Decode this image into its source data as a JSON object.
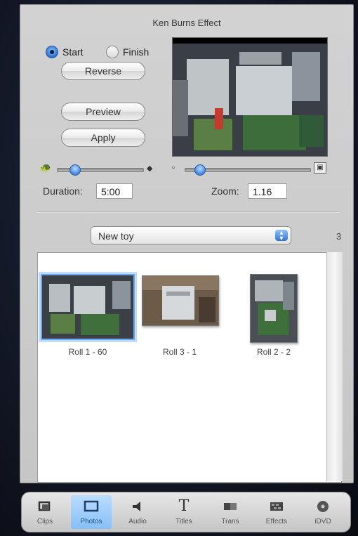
{
  "ken_burns": {
    "title": "Ken Burns Effect",
    "start_label": "Start",
    "finish_label": "Finish",
    "selected": "start",
    "reverse_label": "Reverse",
    "preview_label": "Preview",
    "apply_label": "Apply",
    "duration_label": "Duration:",
    "duration_value": "5:00",
    "zoom_label": "Zoom:",
    "zoom_value": "1.16"
  },
  "album": {
    "selected": "New toy",
    "count": "3"
  },
  "photos": [
    {
      "label": "Roll 1 - 60",
      "selected": true
    },
    {
      "label": "Roll 3 - 1",
      "selected": false
    },
    {
      "label": "Roll 2 - 2",
      "selected": false
    }
  ],
  "toolbar": {
    "items": [
      {
        "label": "Clips",
        "icon": "clips-icon",
        "active": false
      },
      {
        "label": "Photos",
        "icon": "photos-icon",
        "active": true
      },
      {
        "label": "Audio",
        "icon": "audio-icon",
        "active": false
      },
      {
        "label": "Titles",
        "icon": "titles-icon",
        "active": false
      },
      {
        "label": "Trans",
        "icon": "transitions-icon",
        "active": false
      },
      {
        "label": "Effects",
        "icon": "effects-icon",
        "active": false
      },
      {
        "label": "iDVD",
        "icon": "idvd-icon",
        "active": false
      }
    ]
  },
  "colors": {
    "accent": "#3f86e0",
    "panel": "#cbcbcb",
    "selection": "#6aa6ee"
  }
}
